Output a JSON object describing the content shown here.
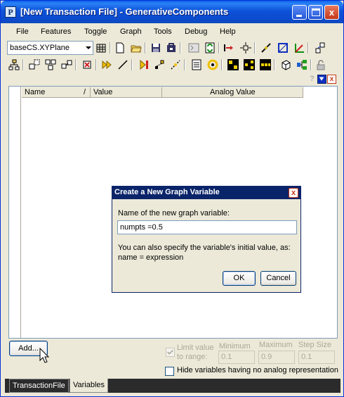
{
  "window": {
    "title": "[New Transaction File] - GenerativeComponents",
    "app_icon_glyph": "P",
    "close_glyph": "x"
  },
  "menu": [
    "File",
    "Features",
    "Toggle",
    "Graph",
    "Tools",
    "Debug",
    "Help"
  ],
  "toolbar": {
    "cs_combo_value": "baseCS.XYPlane"
  },
  "panel": {
    "columns": {
      "name": "Name",
      "sort_marker": "/",
      "value": "Value",
      "analog_value": "Analog Value"
    },
    "help_glyph": "?",
    "close_glyph": "x"
  },
  "dialog": {
    "title": "Create a New Graph Variable",
    "close_glyph": "x",
    "label": "Name of the new graph variable:",
    "input_value": "numpts =0.5",
    "help_line1": "You can also specify the variable's initial value, as:",
    "help_line2": "name = expression",
    "ok_label": "OK",
    "cancel_label": "Cancel"
  },
  "bottom": {
    "add_label": "Add...",
    "limit_line1": "Limit value",
    "limit_line2": "to range:",
    "min_label": "Minimum",
    "max_label": "Maximum",
    "step_label": "Step Size",
    "min_value": "0.1",
    "max_value": "0.9",
    "step_value": "0.1",
    "hide_label": "Hide variables having no analog representation"
  },
  "tabs": [
    "TransactionFile",
    "Variables"
  ],
  "colors": {
    "title_blue": "#0C4BCE",
    "dialog_title": "#0A246A",
    "face": "#ECE9D8"
  }
}
